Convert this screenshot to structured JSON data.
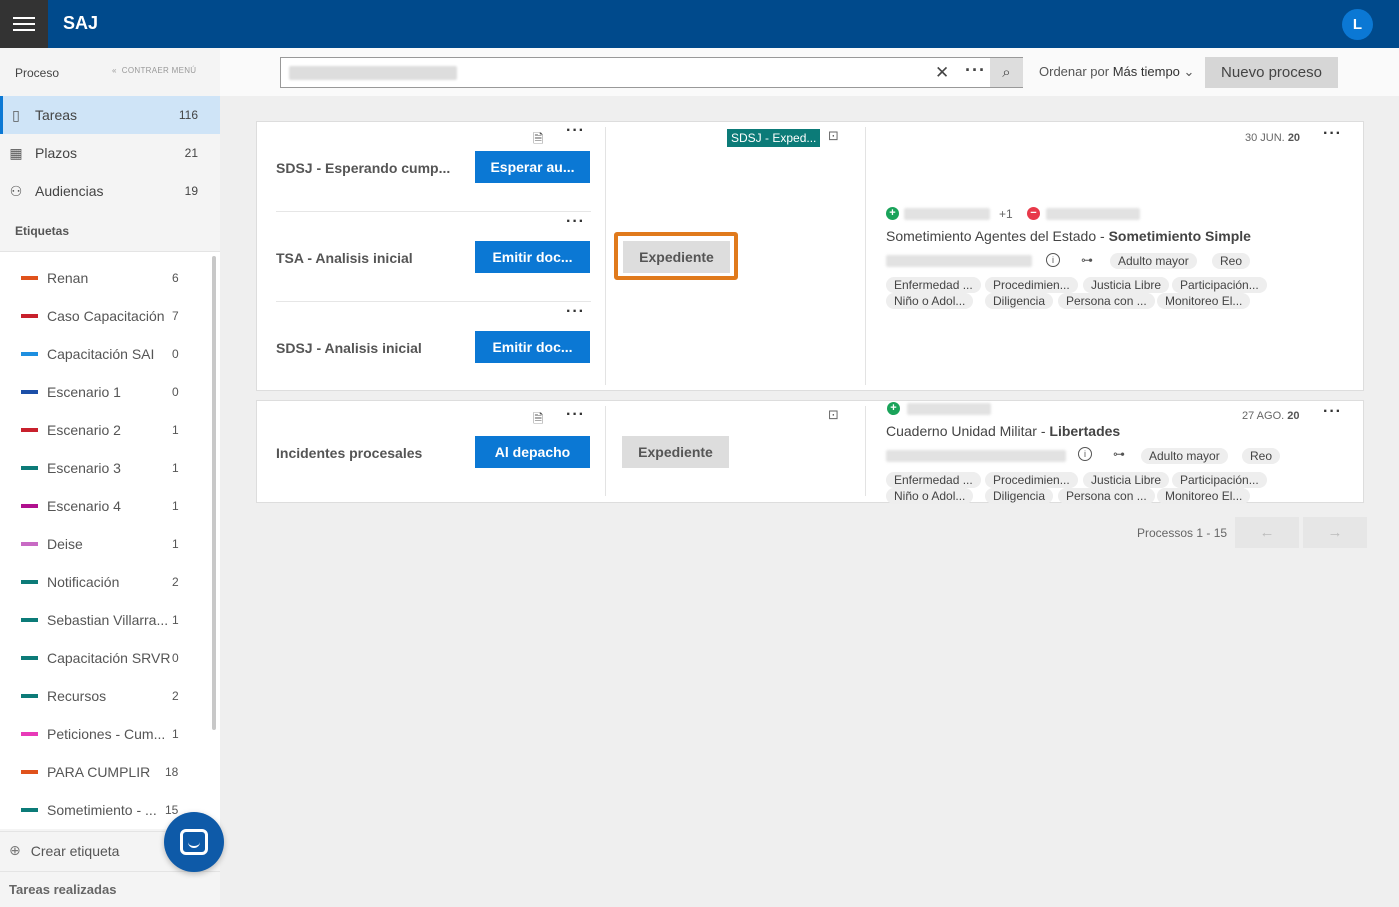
{
  "app": {
    "title": "SAJ",
    "avatar_letter": "L"
  },
  "sidebar": {
    "proceso_label": "Proceso",
    "collapse_label": "CONTRAER MENÚ",
    "nav": [
      {
        "label": "Tareas",
        "count": "116",
        "icon": "bookmark-icon"
      },
      {
        "label": "Plazos",
        "count": "21",
        "icon": "calendar-icon"
      },
      {
        "label": "Audiencias",
        "count": "19",
        "icon": "people-icon"
      }
    ],
    "etiquetas_label": "Etiquetas",
    "tags": [
      {
        "label": "Renan",
        "count": "6",
        "color": "#e0521c"
      },
      {
        "label": "Caso Capacitación",
        "count": "7",
        "color": "#c8202c"
      },
      {
        "label": "Capacitación SAI",
        "count": "0",
        "color": "#1e8fe0"
      },
      {
        "label": "Escenario 1",
        "count": "0",
        "color": "#1c4fa8"
      },
      {
        "label": "Escenario 2",
        "count": "1",
        "color": "#c8202c"
      },
      {
        "label": "Escenario 3",
        "count": "1",
        "color": "#0c7b78"
      },
      {
        "label": "Escenario 4",
        "count": "1",
        "color": "#b0108e"
      },
      {
        "label": "Deise",
        "count": "1",
        "color": "#c86ac4"
      },
      {
        "label": "Notificación",
        "count": "2",
        "color": "#0c7b78"
      },
      {
        "label": "Sebastian Villarra...",
        "count": "1",
        "color": "#0c7b78"
      },
      {
        "label": "Capacitación SRVR",
        "count": "0",
        "color": "#0c7b78"
      },
      {
        "label": "Recursos",
        "count": "2",
        "color": "#0c7b78"
      },
      {
        "label": "Peticiones - Cum...",
        "count": "1",
        "color": "#e83ab8"
      },
      {
        "label": "PARA CUMPLIR",
        "count": "18",
        "color": "#e0521c"
      },
      {
        "label": "Sometimiento - ...",
        "count": "15",
        "color": "#0c7b78"
      }
    ],
    "crear_label": "Crear etiqueta",
    "realizadas_label": "Tareas realizadas"
  },
  "search": {
    "placeholder": "",
    "sort_prefix": "Ordenar por",
    "sort_value": "Más tiempo",
    "new_button": "Nuevo proceso"
  },
  "cards": [
    {
      "tasks": [
        {
          "name": "SDSJ - Esperando cump...",
          "action": "Esperar au..."
        },
        {
          "name": "TSA - Analisis inicial",
          "action": "Emitir doc..."
        },
        {
          "name": "SDSJ - Analisis inicial",
          "action": "Emitir doc..."
        }
      ],
      "tag": "SDSJ - Exped...",
      "expediente": "Expediente",
      "date_prefix": "30 JUN.",
      "date_year": "20",
      "plus_extra": "+1",
      "title_main": "Sometimiento Agentes del Estado - ",
      "title_bold": "Sometimiento Simple",
      "chips_row1": [
        "Adulto mayor",
        "Reo"
      ],
      "chips_row2": [
        "Enfermedad ...",
        "Procedimien...",
        "Justicia Libre",
        "Participación..."
      ],
      "chips_row3": [
        "Niño o Adol...",
        "Diligencia",
        "Persona con ...",
        "Monitoreo El..."
      ]
    },
    {
      "tasks": [
        {
          "name": "Incidentes procesales",
          "action": "Al depacho"
        }
      ],
      "expediente": "Expediente",
      "date_prefix": "27 AGO.",
      "date_year": "20",
      "title_main": "Cuaderno Unidad Militar - ",
      "title_bold": "Libertades",
      "chips_row1": [
        "Adulto mayor",
        "Reo"
      ],
      "chips_row2": [
        "Enfermedad ...",
        "Procedimien...",
        "Justicia Libre",
        "Participación..."
      ],
      "chips_row3": [
        "Niño o Adol...",
        "Diligencia",
        "Persona con ...",
        "Monitoreo El..."
      ]
    }
  ],
  "pager": {
    "label": "Processos 1 - 15",
    "prev": "←",
    "next": "→"
  }
}
